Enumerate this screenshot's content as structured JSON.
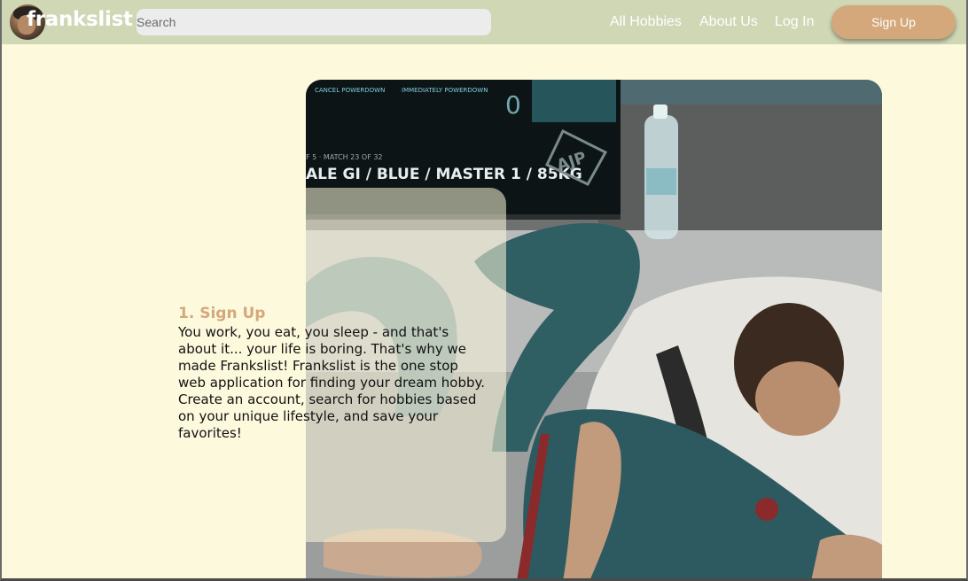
{
  "navbar": {
    "brand": "frankslist",
    "search_placeholder": "Search",
    "links": [
      "All Hobbies",
      "About Us",
      "Log In"
    ],
    "signup_label": "Sign Up",
    "background": "#cfd7b5",
    "accent": "#d4a87a"
  },
  "hero": {
    "scoreboard_top_left": "CANCEL POWERDOWN",
    "scoreboard_top_right": "IMMEDIATELY POWERDOWN",
    "scoreboard_score": "0",
    "scoreboard_line": "ALE GI / BLUE / MASTER 1 / 85KG",
    "scoreboard_small": "F 5 · MATCH 23 OF 32",
    "logo_text": "AJP"
  },
  "card": {
    "title": "1. Sign Up",
    "body": "You work, you eat, you sleep - and that's about it... your life is boring. That's why we made Frankslist! Frankslist is the one stop web application for finding your dream hobby. Create an account, search for hobbies based on your unique lifestyle, and save your favorites!"
  },
  "colors": {
    "page_background": "#fdf9dd",
    "title_color": "#d4a87a"
  }
}
